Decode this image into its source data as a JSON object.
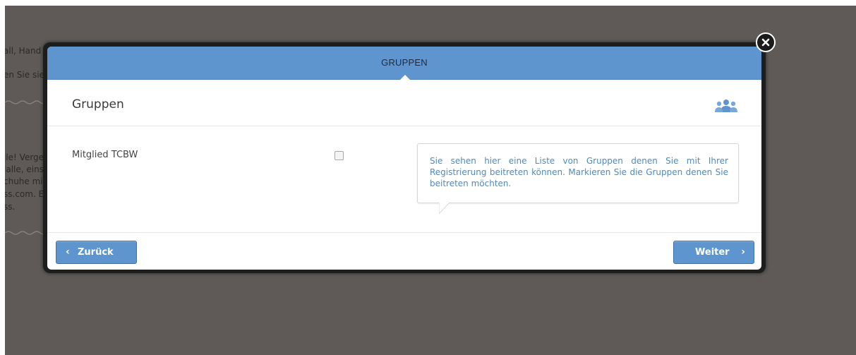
{
  "background": {
    "lines": [
      "all, Hand",
      "en Sie sie",
      "lle! Verge",
      "lalle, eins",
      "chuhe mi",
      "ss.com. E",
      "ss."
    ]
  },
  "modal": {
    "header_title": "GRUPPEN",
    "section_title": "Gruppen",
    "section_icon": "group-icon",
    "row_label": "Mitglied TCBW",
    "checkbox_checked": false,
    "tooltip_text": "Sie sehen hier eine Liste von Gruppen denen Sie mit Ihrer Registrierung beitreten können. Markieren Sie die Gruppen denen Sie beitreten möchten.",
    "back_label": "Zurück",
    "next_label": "Weiter"
  },
  "colors": {
    "header": "#5f95ce",
    "button": "#5f95ce",
    "tooltip_text": "#4a8cc4",
    "backdrop": "#5f5a58"
  }
}
